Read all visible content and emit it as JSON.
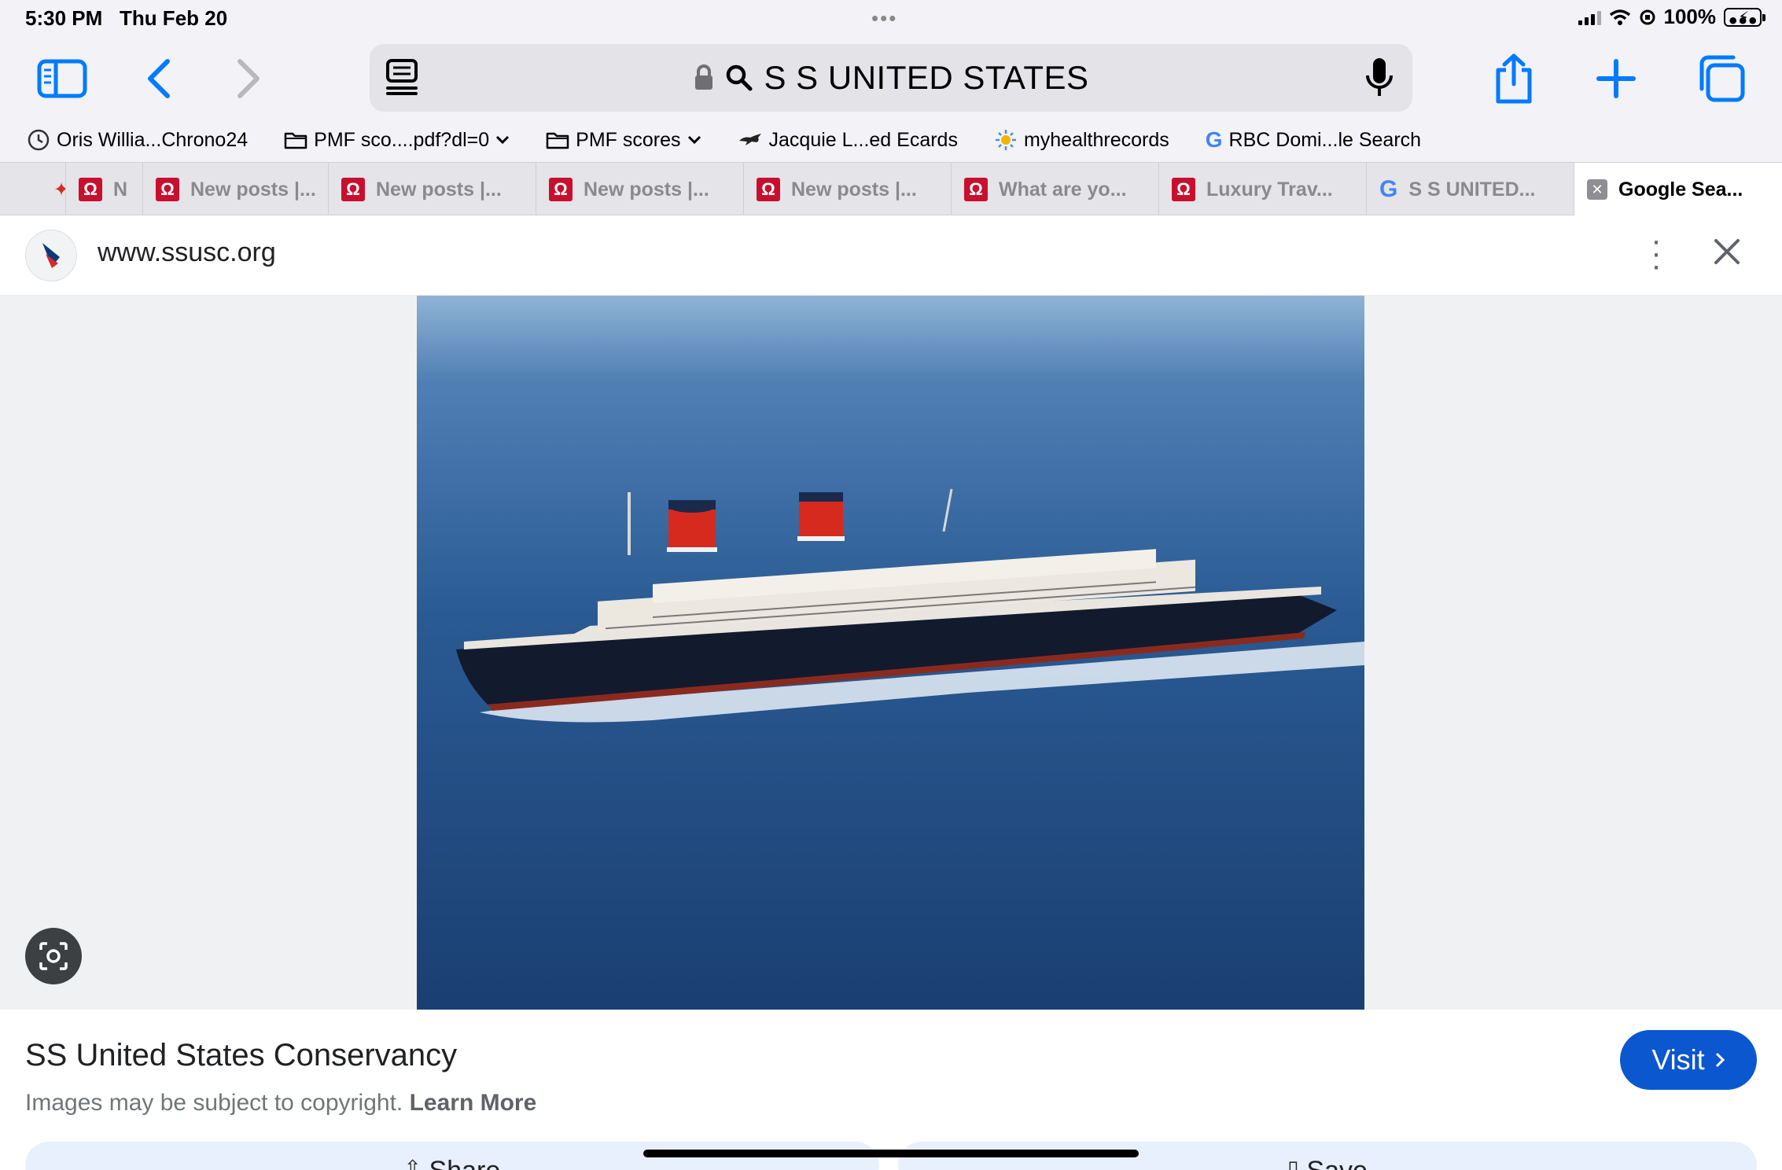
{
  "status_bar": {
    "time": "5:30 PM",
    "date": "Thu Feb 20",
    "battery": "100%",
    "icons": [
      "cellular-signal-icon",
      "wifi-icon",
      "orientation-lock-icon",
      "battery-charging-icon"
    ]
  },
  "toolbar": {
    "address": "S S UNITED STATES",
    "icons": [
      "sidebar-icon",
      "back-icon",
      "forward-icon",
      "reader-icon",
      "lock-icon",
      "search-icon",
      "microphone-icon",
      "share-icon",
      "plus-icon",
      "tabs-icon"
    ]
  },
  "bookmarks": [
    {
      "label": "Oris Willia...Chrono24",
      "icon": "chrono24-icon"
    },
    {
      "label": "PMF sco....pdf?dl=0",
      "icon": "folder-icon"
    },
    {
      "label": "PMF scores",
      "icon": "folder-icon"
    },
    {
      "label": "Jacquie L...ed Ecards",
      "icon": "greyhound-icon"
    },
    {
      "label": "myhealthrecords",
      "icon": "sun-icon"
    },
    {
      "label": "RBC Domi...le Search",
      "icon": "google-icon"
    }
  ],
  "tabs": [
    {
      "label": "",
      "icon": "maple-leaf-icon"
    },
    {
      "label": "N",
      "icon": "omega-icon"
    },
    {
      "label": "New posts |...",
      "icon": "omega-icon"
    },
    {
      "label": "New posts |...",
      "icon": "omega-icon"
    },
    {
      "label": "New posts |...",
      "icon": "omega-icon"
    },
    {
      "label": "New posts |...",
      "icon": "omega-icon"
    },
    {
      "label": "What are yo...",
      "icon": "omega-icon"
    },
    {
      "label": "Luxury Trav...",
      "icon": "omega-icon"
    },
    {
      "label": "S S UNITED...",
      "icon": "google-icon"
    },
    {
      "label": "Google Sea...",
      "icon": "close-tab-icon"
    }
  ],
  "source": {
    "url": "www.ssusc.org"
  },
  "result": {
    "title": "SS United States Conservancy",
    "copyright": "Images may be subject to copyright.",
    "learn_more": "Learn More",
    "visit": "Visit",
    "share": "Share",
    "save": "Save"
  },
  "colors": {
    "accent": "#007aff",
    "visit_button": "#0b57d0",
    "omega_red": "#c8102e",
    "funnel_red": "#d72a1e",
    "sea": "#1d4d86"
  }
}
